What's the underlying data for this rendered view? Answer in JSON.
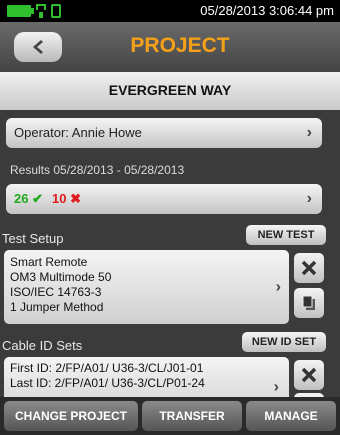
{
  "status_bar": {
    "datetime": "05/28/2013 3:06:44 pm",
    "icons": [
      "battery-icon",
      "ac-power-icon",
      "storage-icon"
    ],
    "battery_color": "#2fbf2f"
  },
  "header": {
    "back_icon": "back-arrow-icon",
    "title": "PROJECT",
    "title_color": "#f4a018"
  },
  "project": {
    "name": "EVERGREEN WAY"
  },
  "operator": {
    "label": "Operator: Annie Howe"
  },
  "results": {
    "date_range": "Results 05/28/2013 - 05/28/2013",
    "pass_count": "26",
    "fail_count": "10",
    "pass_color": "#1faa1f",
    "fail_color": "#e01b1b"
  },
  "test_setup": {
    "section_label": "Test Setup",
    "new_button": "NEW TEST",
    "lines": [
      "Smart Remote",
      "OM3 Multimode 50",
      "ISO/IEC 14763-3",
      "1 Jumper Method"
    ]
  },
  "cable_id_sets": {
    "section_label": "Cable ID Sets",
    "new_button": "NEW ID SET",
    "lines": [
      "First ID: 2/FP/A01/ U36-3/CL/J01-01",
      "Last ID: 2/FP/A01/ U36-3/CL/P01-24"
    ]
  },
  "bottom_bar": {
    "change_project": "CHANGE PROJECT",
    "transfer": "TRANSFER",
    "manage": "MANAGE"
  }
}
